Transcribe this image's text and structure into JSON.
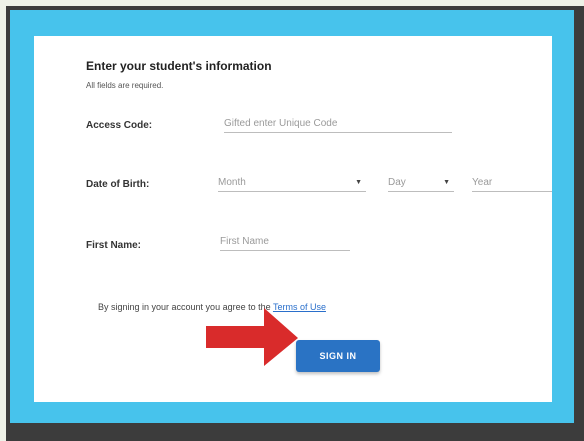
{
  "form": {
    "title": "Enter your student's information",
    "subtitle": "All fields are required.",
    "access_code_label": "Access Code:",
    "access_code_placeholder": "Gifted enter Unique Code",
    "dob_label": "Date of Birth:",
    "month_placeholder": "Month",
    "day_placeholder": "Day",
    "year_placeholder": "Year",
    "first_name_label": "First Name:",
    "first_name_placeholder": "First Name",
    "terms_text": "By signing in your account you agree to the",
    "terms_link": "Terms of Use",
    "signin_label": "SIGN IN"
  },
  "icons": {
    "dropdown": "chevron-down-icon",
    "pointer": "red-arrow-icon"
  },
  "colors": {
    "frame": "#3c3c3c",
    "border": "#47c3ec",
    "button": "#2a73c4",
    "arrow": "#d92b2b",
    "link": "#2a6fcb"
  }
}
